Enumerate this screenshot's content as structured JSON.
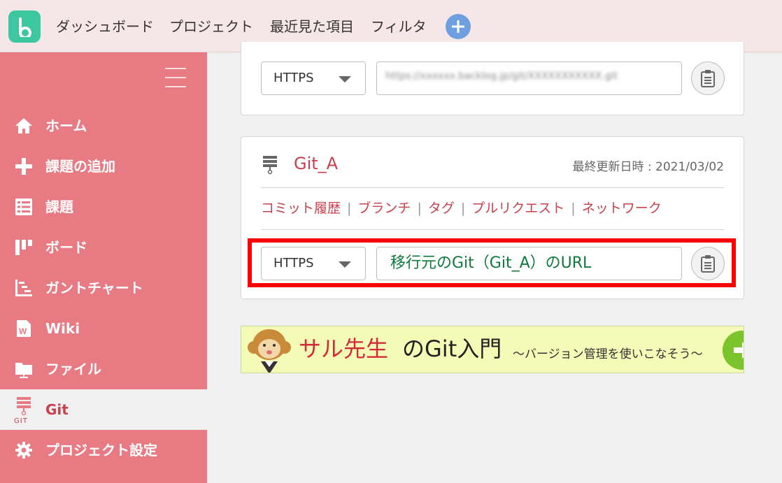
{
  "header": {
    "nav": [
      "ダッシュボード",
      "プロジェクト",
      "最近見た項目",
      "フィルタ"
    ],
    "logo_icon": "b-logo-icon",
    "add_icon": "plus-icon"
  },
  "sidebar": {
    "items": [
      {
        "label": "ホーム",
        "icon": "home-icon"
      },
      {
        "label": "課題の追加",
        "icon": "plus-icon"
      },
      {
        "label": "課題",
        "icon": "list-icon"
      },
      {
        "label": "ボード",
        "icon": "board-icon"
      },
      {
        "label": "ガントチャート",
        "icon": "gantt-icon"
      },
      {
        "label": "Wiki",
        "icon": "wiki-icon"
      },
      {
        "label": "ファイル",
        "icon": "folder-icon"
      },
      {
        "label": "Git",
        "icon": "git-icon",
        "sub": "GIT",
        "active": true
      },
      {
        "label": "プロジェクト設定",
        "icon": "gear-icon"
      }
    ]
  },
  "repo_top": {
    "protocol": "HTTPS",
    "url_blurred": "https://xxxxxx.backlog.jp/git/XXXXXXXXXXX.git"
  },
  "repo_git_a": {
    "name": "Git_A",
    "updated": "最終更新日時 : 2021/03/02",
    "links": [
      "コミット履歴",
      "ブランチ",
      "タグ",
      "プルリクエスト",
      "ネットワーク"
    ],
    "protocol": "HTTPS",
    "url_annotation": "移行元のGit（Git_A）のURL"
  },
  "banner": {
    "title_red": "サル先生",
    "title_black": "のGit入門",
    "subtitle": "〜バージョン管理を使いこなそう〜"
  },
  "colors": {
    "sidebar": "#e87a84",
    "accent": "#c9404e",
    "topbar": "#f5e6e8",
    "logo": "#3cc7a0",
    "highlight": "#ff0000"
  }
}
